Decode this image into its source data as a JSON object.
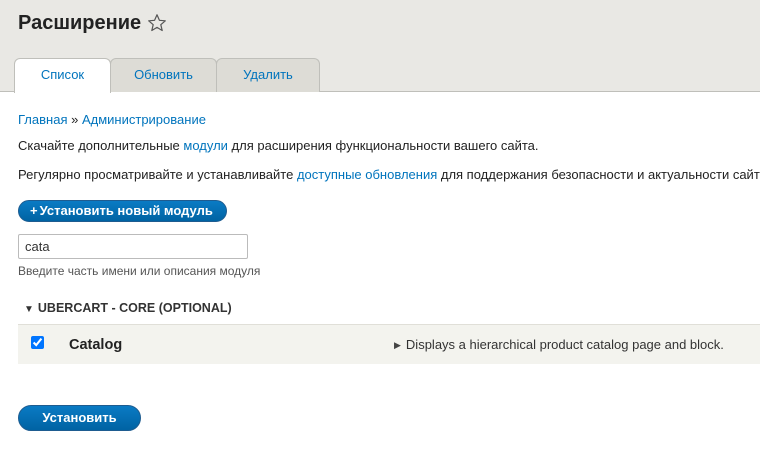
{
  "page": {
    "title": "Расширение"
  },
  "tabs": [
    {
      "label": "Список",
      "active": true
    },
    {
      "label": "Обновить",
      "active": false
    },
    {
      "label": "Удалить",
      "active": false
    }
  ],
  "breadcrumb": {
    "home": "Главная",
    "separator": "»",
    "admin": "Администрирование"
  },
  "description": {
    "line1_before": "Скачайте дополнительные ",
    "line1_link": "модули",
    "line1_after": " для расширения функциональности вашего сайта.",
    "line2_before": "Регулярно просматривайте и устанавливайте ",
    "line2_link": "доступные обновления",
    "line2_after": " для поддержания безопасности и актуальности сайта."
  },
  "actions": {
    "install_new_plus": "+",
    "install_new_label": "Установить новый модуль"
  },
  "filter": {
    "value": "cata",
    "hint": "Введите часть имени или описания модуля"
  },
  "group": {
    "title": "UBERCART - CORE (OPTIONAL)",
    "modules": [
      {
        "name": "Catalog",
        "checked": true,
        "description": "Displays a hierarchical product catalog page and block."
      }
    ]
  },
  "submit": {
    "label": "Установить"
  },
  "colors": {
    "link": "#0074bd",
    "button": "#0071b8",
    "header_bg": "#e9e8e4",
    "row_bg": "#f3f3ee"
  },
  "icons": {
    "favorite": "star-outline-icon",
    "group_toggle": "triangle-down-icon",
    "details_toggle": "triangle-right-icon"
  }
}
